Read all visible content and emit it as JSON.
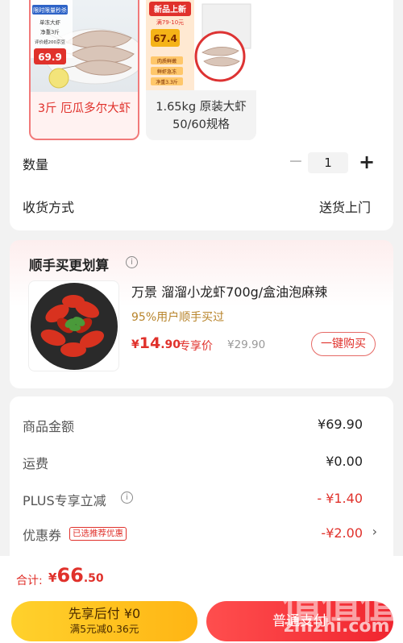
{
  "variants": [
    {
      "label": "3斤 厄瓜多尔大虾",
      "selected": true,
      "badge_top": "限时限量秒杀",
      "badges": [
        "单冻大虾",
        "净重3斤",
        "评价超200京豆"
      ],
      "price_tag": "69.9"
    },
    {
      "label": "1.65kg 原装大虾 50/60规格",
      "selected": false,
      "promo_title": "新品上新",
      "promo_sub": "满79-10元",
      "price_tag": "67.4",
      "badges": [
        "肉质鲜嫩",
        "鲜虾急冻",
        "净重3.3斤"
      ]
    }
  ],
  "quantity": {
    "label": "数量",
    "minus": "−",
    "value": "1",
    "plus": "+"
  },
  "shipping": {
    "label": "收货方式",
    "value": "送货上门"
  },
  "upsell": {
    "title": "顺手买更划算",
    "info_icon": "i",
    "product_name": "万景 溜溜小龙虾700g/盒油泡麻辣",
    "subtext": "95%用户顺手买过",
    "price_currency": "¥",
    "price_int": "14",
    "price_dec": ".90",
    "price_tag": "专享价",
    "original_price": "¥29.90",
    "buy_button": "一键购买"
  },
  "summary": {
    "goods_label": "商品金额",
    "goods_value": "¥69.90",
    "freight_label": "运费",
    "freight_value": "¥0.00",
    "plus_label": "PLUS专享立减",
    "plus_value": "- ¥1.40",
    "coupon_label": "优惠券",
    "coupon_tag": "已选推荐优惠",
    "coupon_value": "-¥2.00",
    "coupon_chevron": "›"
  },
  "footer": {
    "total_label": "合计:",
    "total_currency": "¥",
    "total_int": "66",
    "total_dec": ".50",
    "paylater_line1": "先享后付 ¥0",
    "paylater_line2": "满5元减0.36元",
    "normal_pay": "普通支付"
  },
  "watermark": {
    "text": "值值值",
    "url": "zhizhi.com"
  },
  "colors": {
    "accent_red": "#e0312b",
    "paylater_yellow": "#ffc21e",
    "gold_text": "#b8842b"
  }
}
